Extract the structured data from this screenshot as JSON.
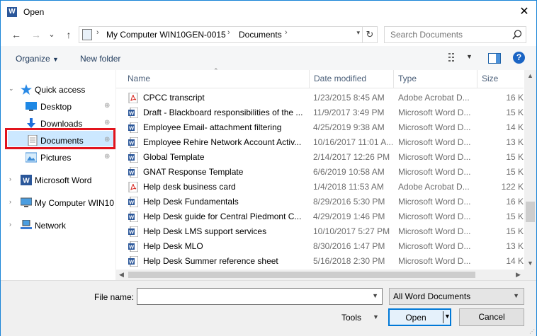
{
  "window": {
    "title": "Open",
    "app_icon": "W",
    "close_glyph": "✕"
  },
  "nav": {
    "back_glyph": "←",
    "forward_glyph": "→",
    "recent_glyph": "⌄",
    "up_glyph": "↑",
    "breadcrumb": [
      "My Computer WIN10GEN-0015",
      "Documents"
    ],
    "separator": "›",
    "refresh_glyph": "↻",
    "search_placeholder": "Search Documents"
  },
  "toolbar": {
    "organize": "Organize",
    "new_folder": "New folder",
    "help_glyph": "?"
  },
  "navpane": {
    "items": [
      {
        "label": "Quick access",
        "icon": "star-icon"
      },
      {
        "label": "Desktop",
        "icon": "desktop-icon",
        "pinned": true
      },
      {
        "label": "Downloads",
        "icon": "downloads-icon",
        "pinned": true
      },
      {
        "label": "Documents",
        "icon": "documents-icon",
        "pinned": true,
        "selected": true
      },
      {
        "label": "Pictures",
        "icon": "pictures-icon",
        "pinned": true
      },
      {
        "label": "Microsoft Word",
        "icon": "word-icon"
      },
      {
        "label": "My Computer WIN10",
        "icon": "computer-icon"
      },
      {
        "label": "Network",
        "icon": "network-icon"
      }
    ],
    "pin_glyph": "📌"
  },
  "files": {
    "columns": [
      "Name",
      "Date modified",
      "Type",
      "Size"
    ],
    "rows": [
      {
        "name": "CPCC transcript",
        "date": "1/23/2015 8:45 AM",
        "type": "Adobe Acrobat D...",
        "size": "16 K",
        "kind": "pdf"
      },
      {
        "name": "Draft - Blackboard responsibilities of the ...",
        "date": "11/9/2017 3:49 PM",
        "type": "Microsoft Word D...",
        "size": "15 K",
        "kind": "word"
      },
      {
        "name": "Employee Email- attachment filtering",
        "date": "4/25/2019 9:38 AM",
        "type": "Microsoft Word D...",
        "size": "14 K",
        "kind": "word"
      },
      {
        "name": "Employee Rehire Network Account Activ...",
        "date": "10/16/2017 11:01 A...",
        "type": "Microsoft Word D...",
        "size": "13 K",
        "kind": "word"
      },
      {
        "name": "Global Template",
        "date": "2/14/2017 12:26 PM",
        "type": "Microsoft Word D...",
        "size": "15 K",
        "kind": "word"
      },
      {
        "name": "GNAT Response Template",
        "date": "6/6/2019 10:58 AM",
        "type": "Microsoft Word D...",
        "size": "15 K",
        "kind": "word"
      },
      {
        "name": "Help desk business card",
        "date": "1/4/2018 11:53 AM",
        "type": "Adobe Acrobat D...",
        "size": "122 K",
        "kind": "pdf"
      },
      {
        "name": "Help Desk Fundamentals",
        "date": "8/29/2016 5:30 PM",
        "type": "Microsoft Word D...",
        "size": "16 K",
        "kind": "word"
      },
      {
        "name": "Help Desk guide for Central Piedmont C...",
        "date": "4/29/2019 1:46 PM",
        "type": "Microsoft Word D...",
        "size": "15 K",
        "kind": "word"
      },
      {
        "name": "Help Desk LMS support services",
        "date": "10/10/2017 5:27 PM",
        "type": "Microsoft Word D...",
        "size": "15 K",
        "kind": "word"
      },
      {
        "name": "Help Desk MLO",
        "date": "8/30/2016 1:47 PM",
        "type": "Microsoft Word D...",
        "size": "13 K",
        "kind": "word"
      },
      {
        "name": "Help Desk Summer reference sheet",
        "date": "5/16/2018 2:30 PM",
        "type": "Microsoft Word D...",
        "size": "14 K",
        "kind": "word"
      }
    ]
  },
  "bottom": {
    "file_name_label": "File name:",
    "file_name_value": "",
    "filter_value": "All Word Documents",
    "tools_label": "Tools",
    "open_label": "Open",
    "cancel_label": "Cancel"
  },
  "colors": {
    "accent": "#0078d7",
    "highlight_box": "#e2141d",
    "selected": "#cce8ff",
    "word_blue": "#2b579a",
    "pdf_red": "#d9302a"
  }
}
